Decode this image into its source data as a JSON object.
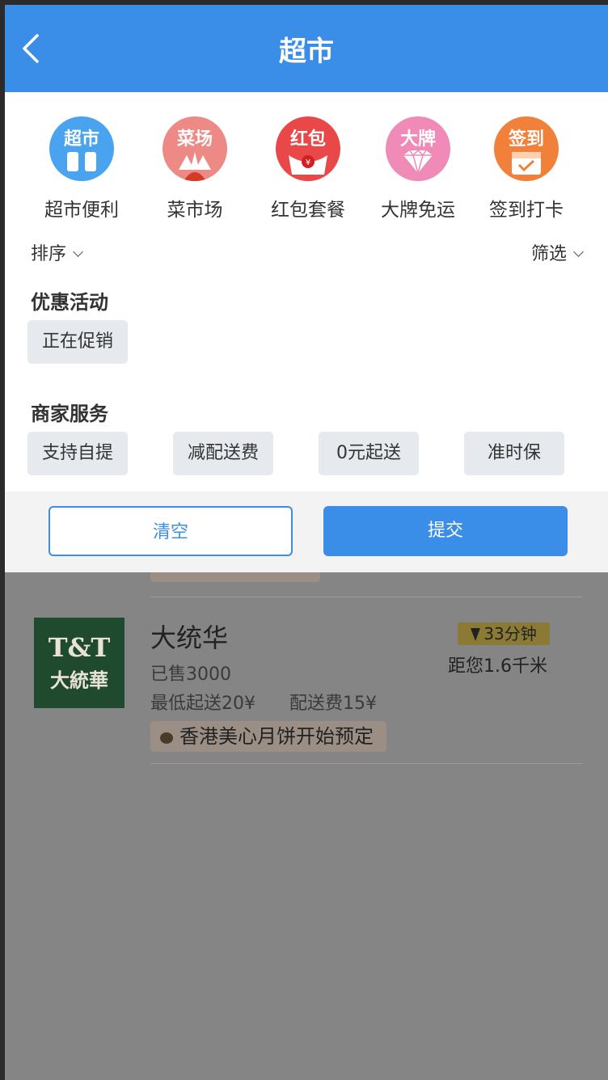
{
  "header": {
    "title": "超市",
    "back_icon": "chevron-left-icon"
  },
  "categories": [
    {
      "icon_text": "超市",
      "label": "超市便利",
      "color": "#4aa3ee",
      "icon": "supermarket-icon"
    },
    {
      "icon_text": "菜场",
      "label": "菜市场",
      "color": "#ee8a86",
      "icon": "vegetable-icon"
    },
    {
      "icon_text": "红包",
      "label": "红包套餐",
      "color": "#e84848",
      "icon": "red-envelope-icon"
    },
    {
      "icon_text": "大牌",
      "label": "大牌免运",
      "color": "#f08ab6",
      "icon": "diamond-icon"
    },
    {
      "icon_text": "签到",
      "label": "签到打卡",
      "color": "#f0803a",
      "icon": "calendar-check-icon"
    }
  ],
  "filter_bar": {
    "sort_label": "排序",
    "filter_label": "筛选"
  },
  "promotions": {
    "title": "优惠活动",
    "chips": [
      "正在促销"
    ]
  },
  "services": {
    "title": "商家服务",
    "chips": [
      "支持自提",
      "减配送费",
      "0元起送",
      "准时保"
    ]
  },
  "actions": {
    "clear_label": "清空",
    "submit_label": "提交"
  },
  "store": {
    "logo_line1": "T&T",
    "logo_line2": "大統華",
    "name": "大统华",
    "sold": "已售3000",
    "min_order": "最低起送20¥",
    "delivery_fee": "配送费15¥",
    "promo": "香港美心月饼开始预定",
    "delivery_time": "33分钟",
    "distance": "距您1.6千米"
  },
  "colors": {
    "primary": "#3b8ee8",
    "overlay": "#858585"
  }
}
